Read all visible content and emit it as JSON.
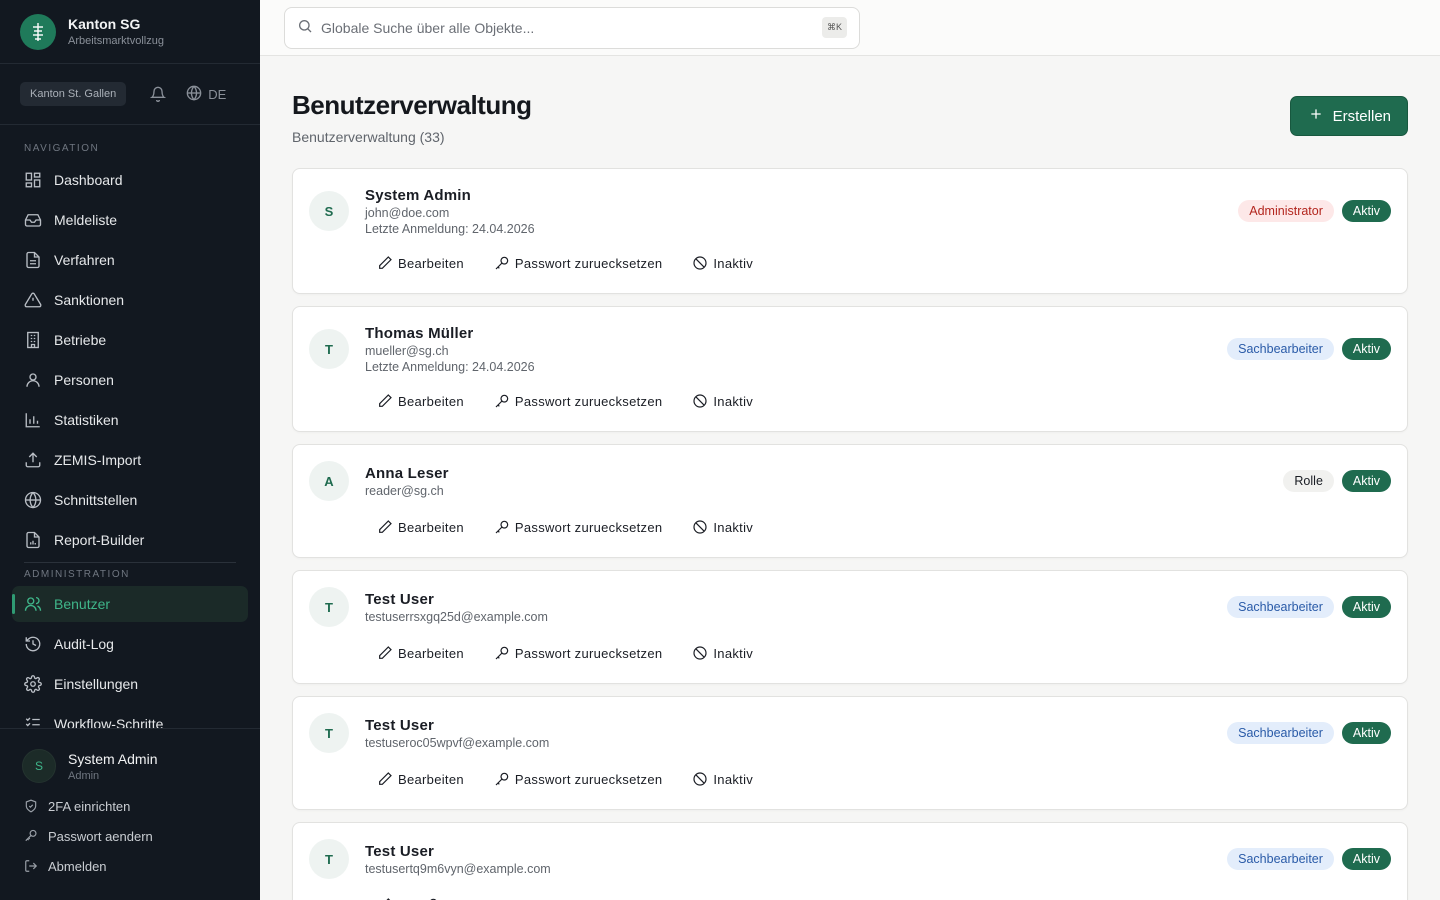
{
  "brand": {
    "title": "Kanton SG",
    "subtitle": "Arbeitsmarktvollzug"
  },
  "toolbar": {
    "org": "Kanton St. Gallen",
    "language": "DE"
  },
  "nav": {
    "section_navigation": "NAVIGATION",
    "items": [
      {
        "label": "Dashboard",
        "icon": "dashboard-icon"
      },
      {
        "label": "Meldeliste",
        "icon": "inbox-icon"
      },
      {
        "label": "Verfahren",
        "icon": "document-icon"
      },
      {
        "label": "Sanktionen",
        "icon": "warning-icon"
      },
      {
        "label": "Betriebe",
        "icon": "building-icon"
      },
      {
        "label": "Personen",
        "icon": "person-icon"
      },
      {
        "label": "Statistiken",
        "icon": "bar-chart-icon"
      },
      {
        "label": "ZEMIS-Import",
        "icon": "upload-icon"
      },
      {
        "label": "Schnittstellen",
        "icon": "globe-icon"
      },
      {
        "label": "Report-Builder",
        "icon": "report-icon"
      }
    ],
    "section_admin": "ADMINISTRATION",
    "admin_items": [
      {
        "label": "Benutzer",
        "icon": "users-icon",
        "active": true
      },
      {
        "label": "Audit-Log",
        "icon": "history-icon"
      },
      {
        "label": "Einstellungen",
        "icon": "gear-icon"
      },
      {
        "label": "Workflow-Schritte",
        "icon": "checklist-icon"
      }
    ]
  },
  "current_user": {
    "initial": "S",
    "name": "System Admin",
    "role": "Admin",
    "links": {
      "twofa": "2FA einrichten",
      "password": "Passwort aendern",
      "logout": "Abmelden"
    }
  },
  "search": {
    "placeholder": "Globale Suche über alle Objekte...",
    "shortcut": "⌘K"
  },
  "page": {
    "title": "Benutzerverwaltung",
    "subtitle": "Benutzerverwaltung (33)",
    "create_label": "Erstellen"
  },
  "action_labels": {
    "edit": "Bearbeiten",
    "reset": "Passwort zuruecksetzen",
    "inactive": "Inaktiv"
  },
  "users": [
    {
      "initial": "S",
      "name": "System Admin",
      "email": "john@doe.com",
      "last_login": "Letzte Anmeldung: 24.04.2026",
      "role": "Administrator",
      "status": "Aktiv"
    },
    {
      "initial": "T",
      "name": "Thomas Müller",
      "email": "mueller@sg.ch",
      "last_login": "Letzte Anmeldung: 24.04.2026",
      "role": "Sachbearbeiter",
      "status": "Aktiv"
    },
    {
      "initial": "A",
      "name": "Anna Leser",
      "email": "reader@sg.ch",
      "role": "Rolle",
      "status": "Aktiv"
    },
    {
      "initial": "T",
      "name": "Test User",
      "email": "testuserrsxgq25d@example.com",
      "role": "Sachbearbeiter",
      "status": "Aktiv"
    },
    {
      "initial": "T",
      "name": "Test User",
      "email": "testuseroc05wpvf@example.com",
      "role": "Sachbearbeiter",
      "status": "Aktiv"
    },
    {
      "initial": "T",
      "name": "Test User",
      "email": "testusertq9m6vyn@example.com",
      "role": "Sachbearbeiter",
      "status": "Aktiv"
    }
  ]
}
